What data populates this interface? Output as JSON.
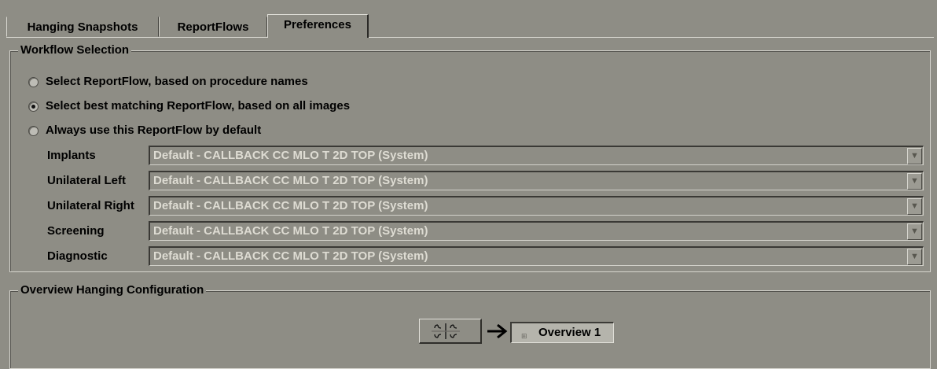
{
  "tabs": [
    {
      "label": "Hanging Snapshots",
      "active": false
    },
    {
      "label": "ReportFlows",
      "active": false
    },
    {
      "label": "Preferences",
      "active": true
    }
  ],
  "workflow": {
    "title": "Workflow Selection",
    "options": [
      {
        "label": "Select ReportFlow, based on procedure names",
        "checked": false
      },
      {
        "label": "Select best matching ReportFlow, based on all images",
        "checked": true
      },
      {
        "label": "Always use this ReportFlow by default",
        "checked": false
      }
    ],
    "flows": [
      {
        "label": "Implants",
        "value": "Default - CALLBACK CC MLO T 2D TOP (System)"
      },
      {
        "label": "Unilateral Left",
        "value": "Default - CALLBACK CC MLO T 2D TOP (System)"
      },
      {
        "label": "Unilateral Right",
        "value": "Default - CALLBACK CC MLO T 2D TOP (System)"
      },
      {
        "label": "Screening",
        "value": "Default - CALLBACK CC MLO T 2D TOP (System)"
      },
      {
        "label": "Diagnostic",
        "value": "Default - CALLBACK CC MLO T 2D TOP (System)"
      }
    ],
    "dropdown_glyph": "▼"
  },
  "overview": {
    "title": "Overview Hanging Configuration",
    "target_label": "Overview 1",
    "mini_icon": "⊞"
  },
  "icons": {
    "hanging_layout": "hanging-layout-icon",
    "arrow": "arrow-right-icon"
  }
}
